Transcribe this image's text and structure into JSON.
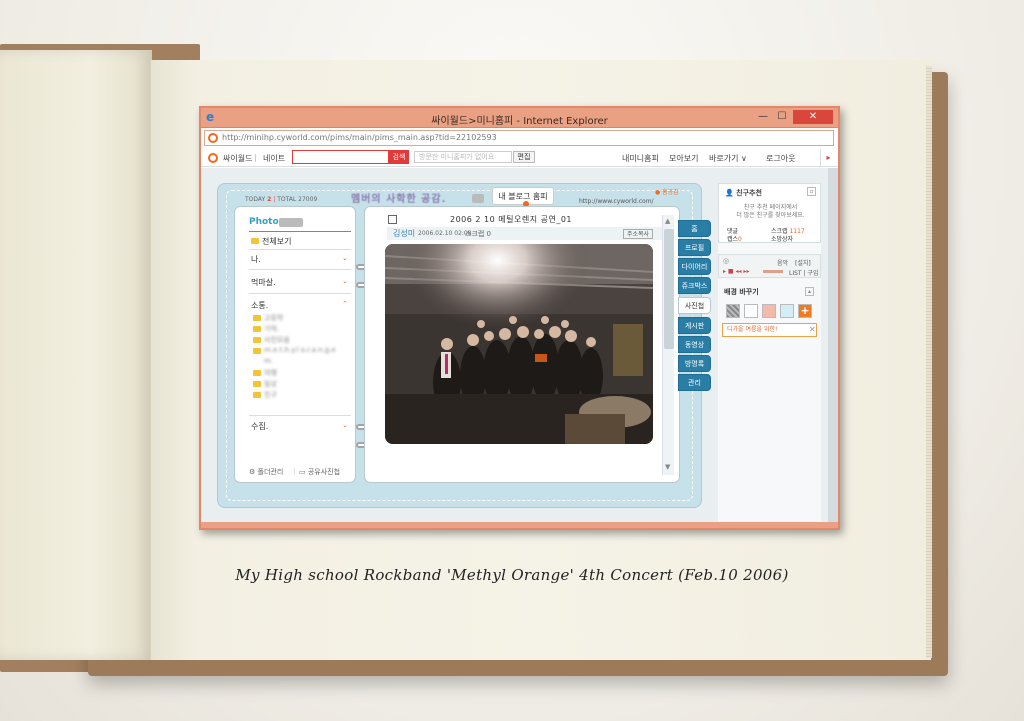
{
  "window": {
    "title": "싸이월드>미니홈피 - Internet Explorer",
    "url": "http://minihp.cyworld.com/pims/main/pims_main.asp?tid=22102593",
    "minimize": "—",
    "maximize": "☐",
    "close": "✕"
  },
  "navbar": {
    "brand": "싸이월드",
    "nate": "네이트",
    "search_label": "검색",
    "visit_placeholder": "방문한 미니홈피가 없어요",
    "edit_label": "편집",
    "links": [
      "내미니홈피",
      "모아보기",
      "바로가기 ∨",
      "로그아웃"
    ],
    "arrow": "▸"
  },
  "minihompy": {
    "today_label": "TODAY",
    "today_value": "2",
    "total_label": "TOTAL",
    "total_value": "27009",
    "title": "멤버의 사학한 공감.",
    "sticker": "내 블로그 홈피",
    "home_link": "● 홈공감",
    "url": "http://www.cyworld.com/"
  },
  "left_panel": {
    "title": "Photo",
    "view_all": "전체보기",
    "sections": [
      "나.",
      "먹마살.",
      "소통.",
      "수집."
    ],
    "folders": [
      "고등학",
      "기억.",
      "사진모음",
      "m.e.t.h.y.l o.r.a.n.g.e",
      "m.",
      "여행",
      "일상",
      "친구"
    ],
    "footer_manage": "폴더관리",
    "footer_share": "공유사진첩"
  },
  "post": {
    "title": "2006 2 10 메틸오렌지 공연_01",
    "author": "김성미",
    "date": "2006.02.10 02:08",
    "scrap": "스크랩 0",
    "address_btn": "주소복사"
  },
  "tabs": [
    "홈",
    "프로필",
    "다이어리",
    "쥬크박스",
    "사진첩",
    "게시판",
    "동영상",
    "방명록",
    "관리"
  ],
  "active_tab": "사진첩",
  "sidebar": {
    "friend_title": "친구추천",
    "friend_desc1": "친구 추천 페이지에서",
    "friend_desc2": "더 많은 친구를 찾아보세요.",
    "comment_label": "댓글",
    "comment_value": "",
    "scrap_label": "스크랩",
    "scrap_value": "1117",
    "gift_label": "캡스",
    "gift_value": "0",
    "wish_label": "소망상자",
    "player_label": "음악",
    "player_setting": "[설치]",
    "player_list": "LIST | 구입",
    "bg_title": "배경 바꾸기",
    "bg_tip": "디가을 여름을 위한!",
    "bg_plus": "+"
  },
  "caption": "My High school Rockband 'Methyl Orange' 4th Concert (Feb.10 2006)",
  "colors": {
    "window_border": "#e4866a",
    "titlebar": "#eaa183",
    "close": "#d9463b",
    "tab": "#2a7ea6",
    "frame": "#c7e1ea",
    "accent": "#f06a1f"
  }
}
